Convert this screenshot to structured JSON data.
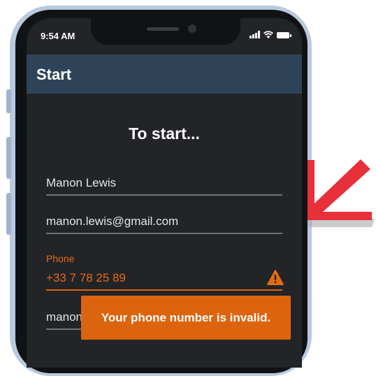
{
  "status_bar": {
    "time": "9:54 AM"
  },
  "app_bar": {
    "title": "Start"
  },
  "form": {
    "heading": "To start...",
    "name_value": "Manon Lewis",
    "email_value": "manon.lewis@gmail.com",
    "phone_label": "Phone",
    "phone_value": "+33 7 78 25 89",
    "partial_field_value": "manon"
  },
  "snackbar": {
    "message": "Your phone number is invalid."
  },
  "icons": {
    "signal": "signal-icon",
    "wifi": "wifi-icon",
    "battery": "battery-icon",
    "warning": "warning-icon",
    "arrow": "arrow-icon"
  },
  "colors": {
    "app_bar": "#2e4358",
    "screen_bg": "#222428",
    "error": "#e56a14",
    "snackbar": "#dd640e",
    "arrow": "#e8303a"
  }
}
